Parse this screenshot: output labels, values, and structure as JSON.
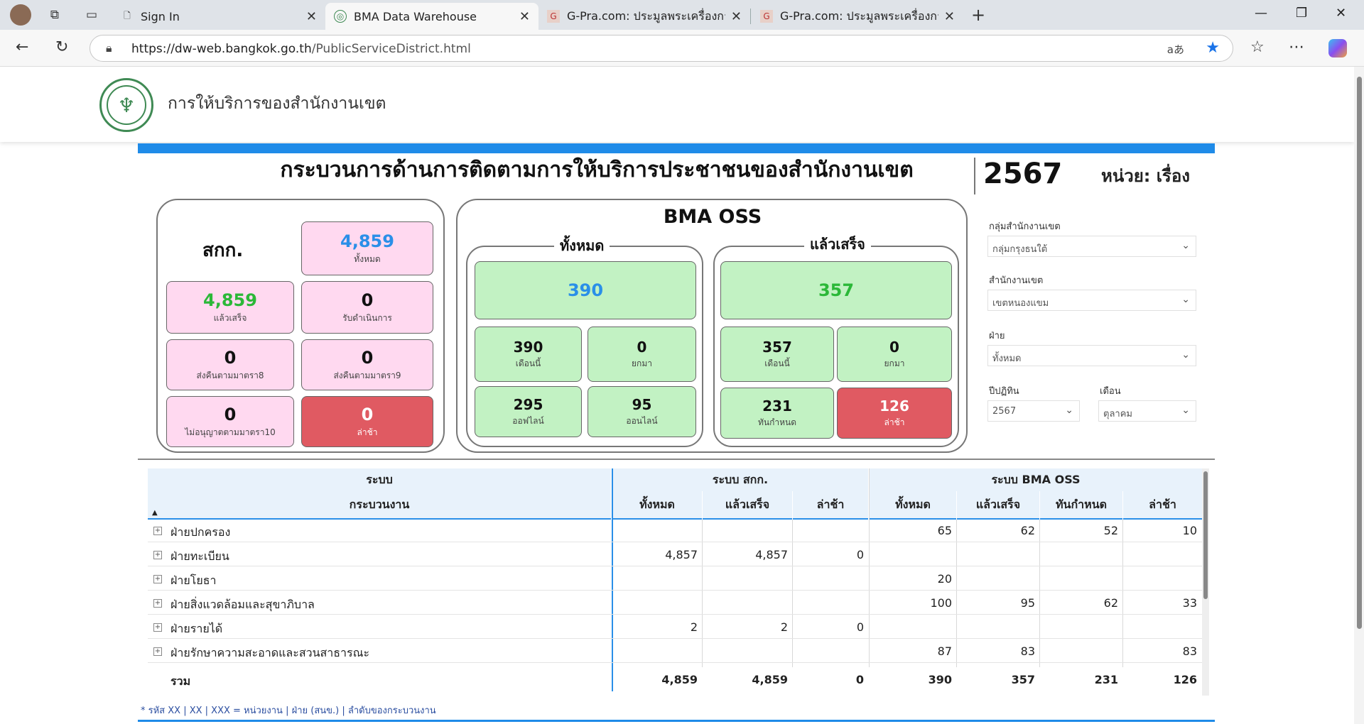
{
  "browser": {
    "tabs": [
      {
        "title": "Sign In"
      },
      {
        "title": "BMA Data Warehouse"
      },
      {
        "title": "G-Pra.com: ประมูลพระเครื่องการันตีพระแท้"
      },
      {
        "title": "G-Pra.com: ประมูลพระเครื่องการันตีพระแท้"
      }
    ],
    "url_host": "https://dw-web.bangkok.go.th",
    "url_path": "/PublicServiceDistrict.html",
    "reader_label": "aあ"
  },
  "site": {
    "title": "การให้บริการของสำนักงานเขต"
  },
  "header": {
    "main_title": "กระบวนการด้านการติดตามการให้บริการประชาชนของสำนักงานเขต",
    "year": "2567",
    "unit": "หน่วย: เรื่อง"
  },
  "skk": {
    "label": "สกก.",
    "total": {
      "value": "4,859",
      "label": "ทั้งหมด"
    },
    "done": {
      "value": "4,859",
      "label": "แล้วเสร็จ"
    },
    "in_progress": {
      "value": "0",
      "label": "รับดำเนินการ"
    },
    "return8": {
      "value": "0",
      "label": "ส่งคืนตามมาตรา8"
    },
    "return9": {
      "value": "0",
      "label": "ส่งคืนตามมาตรา9"
    },
    "denied10": {
      "value": "0",
      "label": "ไม่อนุญาตตามมาตรา10"
    },
    "late": {
      "value": "0",
      "label": "ล่าช้า"
    }
  },
  "oss": {
    "title": "BMA OSS",
    "all": {
      "title": "ทั้งหมด",
      "total": "390",
      "this_month": {
        "value": "390",
        "label": "เดือนนี้"
      },
      "carried": {
        "value": "0",
        "label": "ยกมา"
      },
      "offline": {
        "value": "295",
        "label": "ออฟไลน์"
      },
      "online": {
        "value": "95",
        "label": "ออนไลน์"
      }
    },
    "done": {
      "title": "แล้วเสร็จ",
      "total": "357",
      "this_month": {
        "value": "357",
        "label": "เดือนนี้"
      },
      "carried": {
        "value": "0",
        "label": "ยกมา"
      },
      "on_time": {
        "value": "231",
        "label": "ทันกำหนด"
      },
      "late": {
        "value": "126",
        "label": "ล่าช้า"
      }
    }
  },
  "filters": {
    "district_group": {
      "label": "กลุ่มสำนักงานเขต",
      "value": "กลุ่มกรุงธนใต้"
    },
    "district": {
      "label": "สำนักงานเขต",
      "value": "เขตหนองแขม"
    },
    "division": {
      "label": "ฝ่าย",
      "value": "ทั้งหมด"
    },
    "fiscal_year": {
      "label": "ปีปฏิทิน",
      "value": "2567"
    },
    "month": {
      "label": "เดือน",
      "value": "ตุลาคม"
    }
  },
  "table": {
    "group_headers": {
      "system": "ระบบ",
      "skk": "ระบบ สกก.",
      "oss": "ระบบ BMA OSS"
    },
    "columns": [
      "กระบวนงาน",
      "ทั้งหมด",
      "แล้วเสร็จ",
      "ล่าช้า",
      "ทั้งหมด",
      "แล้วเสร็จ",
      "ทันกำหนด",
      "ล่าช้า"
    ],
    "rows": [
      {
        "name": "ฝ่ายปกครอง",
        "v": [
          "",
          "",
          "",
          "65",
          "62",
          "52",
          "10"
        ]
      },
      {
        "name": "ฝ่ายทะเบียน",
        "v": [
          "4,857",
          "4,857",
          "0",
          "",
          "",
          "",
          ""
        ]
      },
      {
        "name": "ฝ่ายโยธา",
        "v": [
          "",
          "",
          "",
          "20",
          "",
          "",
          ""
        ]
      },
      {
        "name": "ฝ่ายสิ่งแวดล้อมและสุขาภิบาล",
        "v": [
          "",
          "",
          "",
          "100",
          "95",
          "62",
          "33"
        ]
      },
      {
        "name": "ฝ่ายรายได้",
        "v": [
          "2",
          "2",
          "0",
          "",
          "",
          "",
          ""
        ]
      },
      {
        "name": "ฝ่ายรักษาความสะอาดและสวนสาธารณะ",
        "v": [
          "",
          "",
          "",
          "87",
          "83",
          "",
          "83"
        ]
      }
    ],
    "total": {
      "name": "รวม",
      "v": [
        "4,859",
        "4,859",
        "0",
        "390",
        "357",
        "231",
        "126"
      ]
    },
    "footnote": "* รหัส XX | XX | XXX = หน่วยงาน | ฝ่าย (สนข.) | ลำดับของกระบวนงาน"
  }
}
